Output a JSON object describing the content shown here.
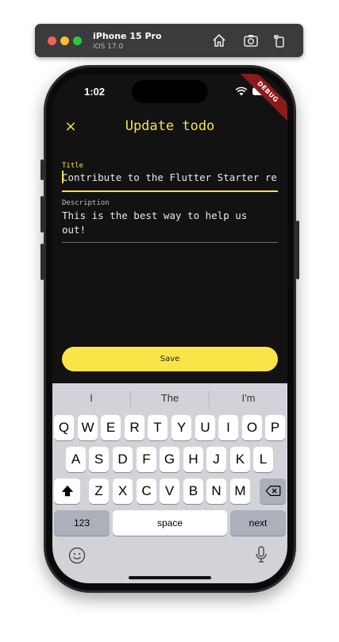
{
  "simulator": {
    "device_name": "iPhone 15 Pro",
    "os_version": "iOS 17.0",
    "toolbar_icons": [
      "home-icon",
      "screenshot-icon",
      "rotate-icon"
    ]
  },
  "status_bar": {
    "time": "1:02",
    "debug_banner": "DEBUG"
  },
  "app": {
    "close_icon": "×",
    "title": "Update todo",
    "accent_color": "#f5e14b",
    "title_field": {
      "label": "Title",
      "value": "Contribute to the Flutter Starter re"
    },
    "description_field": {
      "label": "Description",
      "value_line1": "This is the best way to help us",
      "value_line2": "out!"
    },
    "save_label": "Save"
  },
  "keyboard": {
    "suggestions": [
      "I",
      "The",
      "I'm"
    ],
    "row1": [
      "Q",
      "W",
      "E",
      "R",
      "T",
      "Y",
      "U",
      "I",
      "O",
      "P"
    ],
    "row2": [
      "A",
      "S",
      "D",
      "F",
      "G",
      "H",
      "J",
      "K",
      "L"
    ],
    "row3": [
      "Z",
      "X",
      "C",
      "V",
      "B",
      "N",
      "M"
    ],
    "numbers_label": "123",
    "space_label": "space",
    "return_label": "next"
  }
}
